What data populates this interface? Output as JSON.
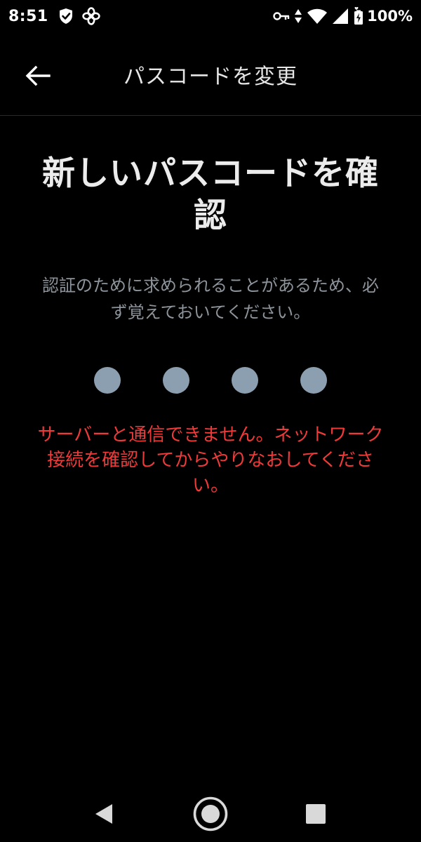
{
  "status_bar": {
    "time": "8:51",
    "battery": "100%",
    "icons_left": [
      "shield-check-icon",
      "pinwheel-icon"
    ],
    "icons_right": [
      "vpn-key-icon",
      "data-arrows-icon",
      "wifi-icon",
      "signal-icon",
      "battery-charging-icon"
    ]
  },
  "app_bar": {
    "title": "パスコードを変更",
    "back_icon": "arrow-left-icon"
  },
  "main": {
    "title": "新しいパスコードを確認",
    "subtitle": "認証のために求められることがあるため、必ず覚えておいてください。",
    "error": "サーバーと通信できません。ネットワーク接続を確認してからやりなおしてください。",
    "passcode_length": 4,
    "dot_color": "#8c9fb1",
    "error_color": "#ef3a3a"
  },
  "nav_bar": {
    "icons": [
      "nav-back-triangle-icon",
      "nav-home-circle-icon",
      "nav-recents-square-icon"
    ]
  }
}
